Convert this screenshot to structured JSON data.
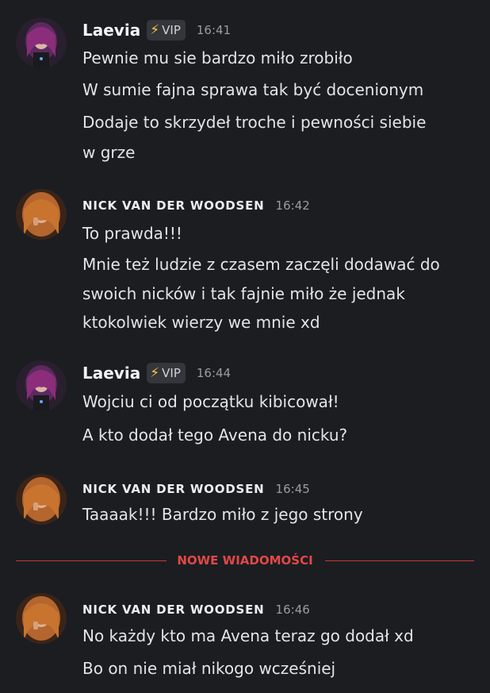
{
  "messages": [
    {
      "author": "Laevia",
      "badge": "VIP",
      "badge_icon": "lightning-bolt-icon",
      "time": "16:41",
      "lines": [
        "Pewnie mu sie bardzo miło zrobiło",
        "W sumie fajna sprawa tak być docenionym",
        "Dodaje to skrzydeł troche i pewności siebie",
        "w grze"
      ]
    },
    {
      "author": "NICK VAN DER WOODSEN",
      "time": "16:42",
      "lines": [
        "To prawda!!!",
        "Mnie też ludzie z czasem zaczęli dodawać do",
        "swoich nicków i tak fajnie miło że jednak",
        "ktokolwiek wierzy we mnie xd"
      ]
    },
    {
      "author": "Laevia",
      "badge": "VIP",
      "badge_icon": "lightning-bolt-icon",
      "time": "16:44",
      "lines": [
        "Wojciu ci od początku kibicował!",
        "A kto dodał tego Avena do nicku?"
      ]
    },
    {
      "author": "NICK VAN DER WOODSEN",
      "time": "16:45",
      "lines": [
        "Taaaak!!! Bardzo miło z jego strony"
      ]
    },
    {
      "author": "NICK VAN DER WOODSEN",
      "time": "16:46",
      "lines": [
        "No każdy kto ma Avena teraz go dodał xd",
        "Bo on nie miał nikogo wcześniej"
      ]
    }
  ],
  "divider": {
    "label": "NOWE WIADOMOŚCI"
  },
  "colors": {
    "background": "#1c1d21",
    "divider_red": "#e24848",
    "badge_bolt": "#f5c542",
    "timestamp": "#9a9ca3"
  }
}
